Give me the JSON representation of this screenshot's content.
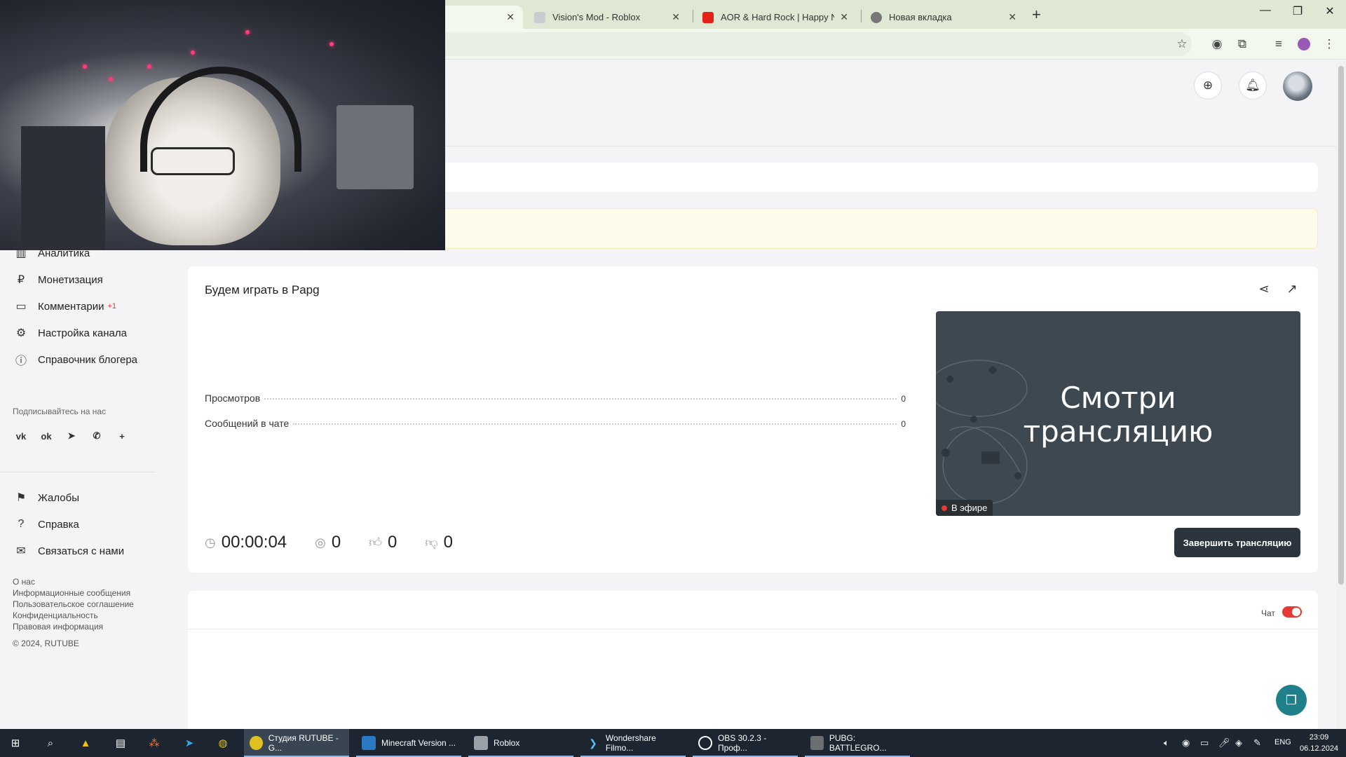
{
  "browser": {
    "tabs": [
      {
        "label": "",
        "active": true
      },
      {
        "label": "Vision's Mod - Roblox"
      },
      {
        "label": "AOR & Hard Rock | Happy New"
      },
      {
        "label": "Новая вкладка"
      }
    ],
    "new_tab": "+"
  },
  "sidebar": {
    "items": [
      {
        "label": "Аналитика",
        "icon": "chart-icon"
      },
      {
        "label": "Монетизация",
        "icon": "ruble-icon"
      },
      {
        "label": "Комментарии",
        "icon": "comment-icon",
        "badge": "+1"
      },
      {
        "label": "Настройка канала",
        "icon": "gear-icon"
      },
      {
        "label": "Справочник блогера",
        "icon": "info-icon"
      }
    ],
    "follow_title": "Подписывайтесь на нас",
    "socials": [
      "vk-icon",
      "ok-icon",
      "telegram-icon",
      "viber-icon",
      "plus-icon"
    ],
    "bottom_items": [
      {
        "label": "Жалобы",
        "icon": "flag-icon"
      },
      {
        "label": "Справка",
        "icon": "help-icon"
      },
      {
        "label": "Связаться с нами",
        "icon": "mail-icon"
      }
    ],
    "footer_links": [
      "О нас",
      "Информационные сообщения",
      "Пользовательское соглашение",
      "Конфиденциальность",
      "Правовая информация"
    ],
    "copyright": "© 2024, RUTUBE"
  },
  "stream": {
    "title": "Будем играть в Papg",
    "stats": [
      {
        "label": "Просмотров",
        "value": "0"
      },
      {
        "label": "Сообщений в чате",
        "value": "0"
      }
    ],
    "timer": "00:00:04",
    "viewers": "0",
    "likes": "0",
    "dislikes": "0",
    "preview_text_line1": "Смотри",
    "preview_text_line2": "трансляцию",
    "live_label": "В эфире",
    "end_button": "Завершить трансляцию"
  },
  "chat": {
    "label": "Чат",
    "enabled": true
  },
  "taskbar": {
    "apps": [
      {
        "label": "Студия RUTUBE - G...",
        "icon": "chrome-icon",
        "active": true
      },
      {
        "label": "Minecraft Version ...",
        "icon": "minecraft-icon"
      },
      {
        "label": "Roblox",
        "icon": "roblox-icon"
      },
      {
        "label": "Wondershare Filmo...",
        "icon": "filmora-icon"
      },
      {
        "label": "OBS 30.2.3 - Проф...",
        "icon": "obs-icon"
      },
      {
        "label": "PUBG: BATTLEGRO...",
        "icon": "pubg-icon"
      }
    ],
    "lang": "ENG",
    "time": "23:09",
    "date": "06.12.2024"
  },
  "colors": {
    "accent": "#e53935",
    "button_dark": "#2c353d",
    "support": "#1f7f8a"
  }
}
